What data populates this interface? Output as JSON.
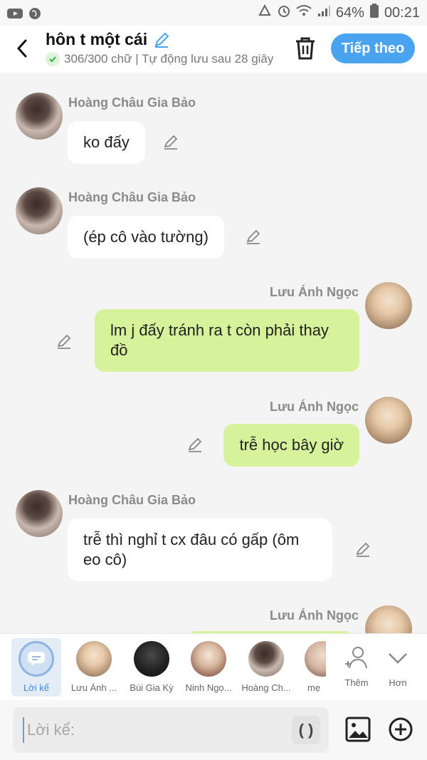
{
  "status_bar": {
    "battery": "64%",
    "time": "00:21"
  },
  "header": {
    "title": "hôn t một cái",
    "subtitle": "306/300 chữ | Tự động lưu sau 28 giây",
    "next_label": "Tiếp theo"
  },
  "messages": [
    {
      "sender": "Hoàng Châu Gia Bảo",
      "text": "ko đấy",
      "side": "left"
    },
    {
      "sender": "Hoàng Châu Gia Bảo",
      "text": "(ép cô vào tường)",
      "side": "left"
    },
    {
      "sender": "Lưu Ánh Ngọc",
      "text": "lm j đấy tránh ra t còn phải thay đồ",
      "side": "right"
    },
    {
      "sender": "Lưu Ánh Ngọc",
      "text": "trễ học bây giờ",
      "side": "right"
    },
    {
      "sender": "Hoàng Châu Gia Bảo",
      "text": "trễ thì nghỉ t cx đâu có gấp (ôm eo cô)",
      "side": "left"
    },
    {
      "sender": "Lưu Ánh Ngọc",
      "text": "",
      "side": "right"
    }
  ],
  "characters": [
    {
      "label": "Lời kể"
    },
    {
      "label": "Lưu Ánh ..."
    },
    {
      "label": "Bùi Gia Kỳ"
    },
    {
      "label": "Ninh Ngọ..."
    },
    {
      "label": "Hoàng Ch..."
    },
    {
      "label": "mẹ"
    },
    {
      "label": "Thêm"
    },
    {
      "label": "Hơn"
    }
  ],
  "composer": {
    "placeholder": "Lời kể:",
    "paren_label": "( )"
  },
  "colors": {
    "accent": "#4aa3ee",
    "bubble_right": "#d6f29a",
    "bubble_left": "#ffffff"
  }
}
